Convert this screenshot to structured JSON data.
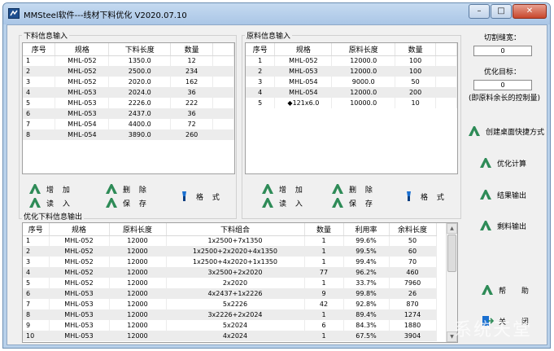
{
  "window": {
    "title": "MMSteel软件---线材下料优化 V2020.07.10",
    "minimize": "–",
    "maximize": "□",
    "close": "✕"
  },
  "cutting": {
    "title": "下料信息输入",
    "columns": [
      "序号",
      "规格",
      "下料长度",
      "数量"
    ],
    "rows": [
      [
        "1",
        "MHL-052",
        "1350.0",
        "12"
      ],
      [
        "2",
        "MHL-052",
        "2500.0",
        "234"
      ],
      [
        "3",
        "MHL-052",
        "2020.0",
        "162"
      ],
      [
        "4",
        "MHL-053",
        "2024.0",
        "36"
      ],
      [
        "5",
        "MHL-053",
        "2226.0",
        "222"
      ],
      [
        "6",
        "MHL-053",
        "2437.0",
        "36"
      ],
      [
        "7",
        "MHL-054",
        "4400.0",
        "72"
      ],
      [
        "8",
        "MHL-054",
        "3890.0",
        "260"
      ]
    ],
    "buttons": {
      "add": "增 加",
      "delete": "删 除",
      "format": "格 式",
      "read": "读 入",
      "save": "保 存"
    }
  },
  "raw": {
    "title": "原料信息输入",
    "columns": [
      "序号",
      "规格",
      "原料长度",
      "数量"
    ],
    "rows": [
      [
        "1",
        "MHL-052",
        "12000.0",
        "100"
      ],
      [
        "2",
        "MHL-053",
        "12000.0",
        "100"
      ],
      [
        "3",
        "MHL-054",
        "9000.0",
        "50"
      ],
      [
        "4",
        "MHL-054",
        "12000.0",
        "200"
      ],
      [
        "5",
        "◆121x6.0",
        "10000.0",
        "10"
      ]
    ],
    "buttons": {
      "add": "增 加",
      "delete": "删 除",
      "format": "格 式",
      "read": "读 入",
      "save": "保 存"
    }
  },
  "settings": {
    "kerf_label": "切割缝宽：",
    "kerf_value": "0",
    "target_label": "优化目标：",
    "target_value": "0",
    "target_note": "(即原料余长的控制量)"
  },
  "side_buttons": {
    "shortcut": "创建桌面快捷方式",
    "optimize": "优化计算",
    "output": "结果输出",
    "leftover": "剩料输出",
    "help": "帮 助",
    "close": "关 闭"
  },
  "output": {
    "title": "优化下料信息输出",
    "columns": [
      "序号",
      "规格",
      "原料长度",
      "下料组合",
      "数量",
      "利用率",
      "余料长度"
    ],
    "rows": [
      [
        "1",
        "MHL-052",
        "12000",
        "1x2500+7x1350",
        "1",
        "99.6%",
        "50"
      ],
      [
        "2",
        "MHL-052",
        "12000",
        "1x2500+2x2020+4x1350",
        "1",
        "99.5%",
        "60"
      ],
      [
        "3",
        "MHL-052",
        "12000",
        "1x2500+4x2020+1x1350",
        "1",
        "99.4%",
        "70"
      ],
      [
        "4",
        "MHL-052",
        "12000",
        "3x2500+2x2020",
        "77",
        "96.2%",
        "460"
      ],
      [
        "5",
        "MHL-052",
        "12000",
        "2x2020",
        "1",
        "33.7%",
        "7960"
      ],
      [
        "6",
        "MHL-053",
        "12000",
        "4x2437+1x2226",
        "9",
        "99.8%",
        "26"
      ],
      [
        "7",
        "MHL-053",
        "12000",
        "5x2226",
        "42",
        "92.8%",
        "870"
      ],
      [
        "8",
        "MHL-053",
        "12000",
        "3x2226+2x2024",
        "1",
        "89.4%",
        "1274"
      ],
      [
        "9",
        "MHL-053",
        "12000",
        "5x2024",
        "6",
        "84.3%",
        "1880"
      ],
      [
        "10",
        "MHL-053",
        "12000",
        "4x2024",
        "1",
        "67.5%",
        "3904"
      ]
    ]
  },
  "watermark": "系统天堂",
  "colors": {
    "window_frame": "#b9d1ea",
    "client": "#f0f0f0",
    "icon_green": "#2e8b57",
    "format_icon": "#1a6fd0"
  }
}
